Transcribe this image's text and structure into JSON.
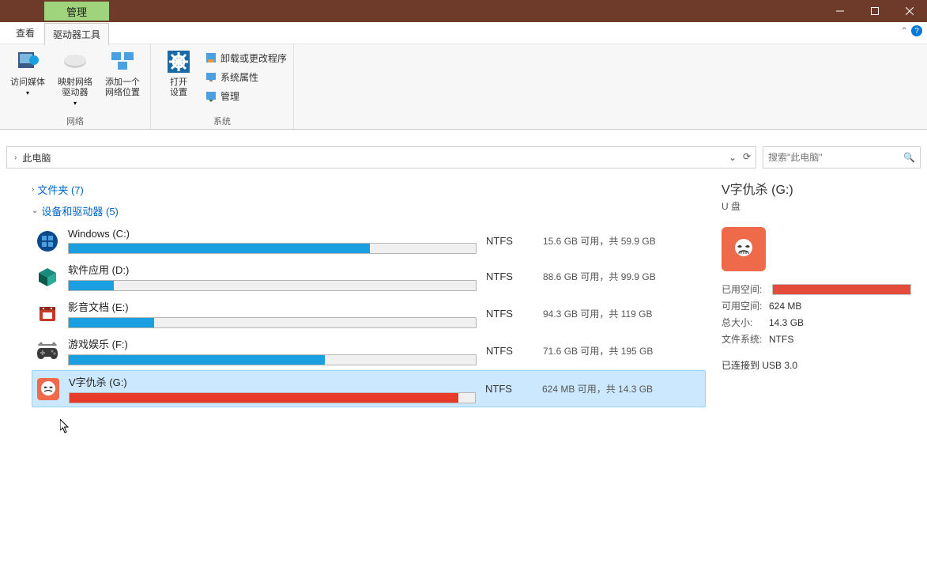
{
  "titlebar": {
    "manage_tab": "管理"
  },
  "menubar": {
    "view": "查看",
    "drive_tools": "驱动器工具"
  },
  "ribbon": {
    "group_network_label": "网络",
    "group_system_label": "系统",
    "btn_access_media": "访问媒体",
    "btn_map_drive": "映射网络\n驱动器",
    "btn_add_location": "添加一个\n网络位置",
    "btn_open_settings": "打开\n设置",
    "btn_uninstall": "卸载或更改程序",
    "btn_sys_props": "系统属性",
    "btn_manage": "管理"
  },
  "addr": {
    "this_pc": "此电脑"
  },
  "search": {
    "placeholder": "搜索\"此电脑\""
  },
  "sections": {
    "folders": "文件夹 (7)",
    "devices": "设备和驱动器 (5)"
  },
  "drives": [
    {
      "name": "Windows (C:)",
      "fs": "NTFS",
      "stats": "15.6 GB 可用，共 59.9 GB",
      "fill_pct": 74,
      "color": "blue",
      "icon": "windows"
    },
    {
      "name": "软件应用 (D:)",
      "fs": "NTFS",
      "stats": "88.6 GB 可用，共 99.9 GB",
      "fill_pct": 11,
      "color": "blue",
      "icon": "cube"
    },
    {
      "name": "影音文档 (E:)",
      "fs": "NTFS",
      "stats": "94.3 GB 可用，共 119 GB",
      "fill_pct": 21,
      "color": "blue",
      "icon": "media"
    },
    {
      "name": "游戏娱乐 (F:)",
      "fs": "NTFS",
      "stats": "71.6 GB 可用，共 195 GB",
      "fill_pct": 63,
      "color": "blue",
      "icon": "gamepad"
    },
    {
      "name": "V字仇杀 (G:)",
      "fs": "NTFS",
      "stats": "624 MB 可用，共 14.3 GB",
      "fill_pct": 96,
      "color": "red",
      "icon": "mask",
      "selected": true
    }
  ],
  "details": {
    "title": "V字仇杀 (G:)",
    "subtitle": "U 盘",
    "used_label": "已用空间:",
    "avail_label": "可用空间:",
    "avail_value": "624 MB",
    "total_label": "总大小:",
    "total_value": "14.3 GB",
    "fs_label": "文件系统:",
    "fs_value": "NTFS",
    "conn": "已连接到 USB 3.0"
  }
}
